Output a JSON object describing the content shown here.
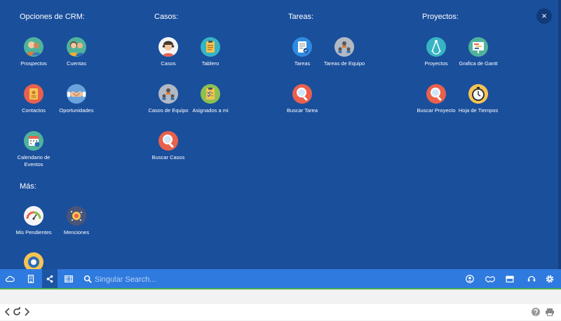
{
  "menu": {
    "close_glyph": "×",
    "sections": [
      {
        "title": "Opciones de CRM:",
        "items": [
          {
            "label": "Prospectos",
            "icon": "prospects-icon"
          },
          {
            "label": "Cuentas",
            "icon": "accounts-icon"
          },
          {
            "label": "Contactos",
            "icon": "contacts-icon"
          },
          {
            "label": "Oportunidades",
            "icon": "opportunities-icon"
          },
          {
            "label": "Calendario de Eventos",
            "icon": "calendar-icon"
          }
        ]
      },
      {
        "title": "Casos:",
        "items": [
          {
            "label": "Casos",
            "icon": "cases-icon"
          },
          {
            "label": "Tablero",
            "icon": "board-icon"
          },
          {
            "label": "Casos de Equipo",
            "icon": "team-cases-icon"
          },
          {
            "label": "Asignados a mi",
            "icon": "assigned-icon"
          },
          {
            "label": "Buscar Casos",
            "icon": "search-cases-icon"
          }
        ]
      },
      {
        "title": "Tareas:",
        "items": [
          {
            "label": "Tareas",
            "icon": "tasks-icon"
          },
          {
            "label": "Tareas de Equipo",
            "icon": "team-tasks-icon"
          },
          {
            "label": "Buscar Tarea",
            "icon": "search-task-icon"
          }
        ]
      },
      {
        "title": "Proyectos:",
        "items": [
          {
            "label": "Proyectos",
            "icon": "projects-icon"
          },
          {
            "label": "Grafica de Gantt",
            "icon": "gantt-icon"
          },
          {
            "label": "Buscar Proyecto",
            "icon": "search-project-icon"
          },
          {
            "label": "Hoja de Tiempos",
            "icon": "timesheet-icon"
          }
        ]
      },
      {
        "title": "Más:",
        "items": [
          {
            "label": "Mis Pendientes",
            "icon": "pending-gauge-icon"
          },
          {
            "label": "Menciones",
            "icon": "mentions-icon"
          }
        ]
      }
    ]
  },
  "taskbar": {
    "search_placeholder": "Singular Search...",
    "icons": [
      "cloud-icon",
      "building-icon",
      "share-icon",
      "film-icon",
      "search-icon",
      "user-icon",
      "handshake-icon",
      "store-icon",
      "support-icon",
      "gear-icon"
    ]
  },
  "colors": {
    "menu_bg": "#1a4f9c",
    "taskbar_bg": "#2f7ade",
    "accent_green": "#4caf50"
  }
}
